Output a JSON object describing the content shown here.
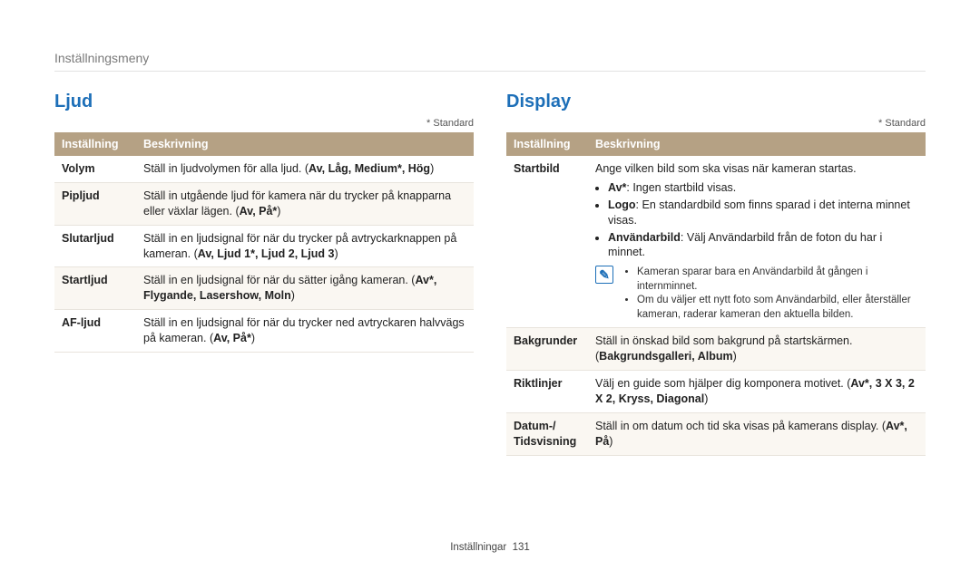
{
  "breadcrumb": "Inställningsmeny",
  "standard_note": "* Standard",
  "header": {
    "col_setting": "Inställning",
    "col_desc": "Beskrivning"
  },
  "ljud": {
    "title": "Ljud",
    "rows": [
      {
        "name": "Volym",
        "desc": "Ställ in ljudvolymen för alla ljud. (",
        "opts": "Av, Låg, Medium*, Hög",
        "tail": ")"
      },
      {
        "name": "Pipljud",
        "desc": "Ställ in utgående ljud för kamera när du trycker på knapparna eller växlar lägen. (",
        "opts": "Av, På*",
        "tail": ")"
      },
      {
        "name": "Slutarljud",
        "desc": "Ställ in en ljudsignal för när du trycker på avtryckarknappen på kameran. (",
        "opts": "Av, Ljud 1*, Ljud 2, Ljud 3",
        "tail": ")"
      },
      {
        "name": "Startljud",
        "desc": "Ställ in en ljudsignal för när du sätter igång kameran. (",
        "opts": "Av*, Flygande, Lasershow, Moln",
        "tail": ")"
      },
      {
        "name": "AF-ljud",
        "desc": "Ställ in en ljudsignal för när du trycker ned avtryckaren halvvägs på kameran. (",
        "opts": "Av, På*",
        "tail": ")"
      }
    ]
  },
  "display": {
    "title": "Display",
    "startbild": {
      "name": "Startbild",
      "intro": "Ange vilken bild som ska visas när kameran startas.",
      "bullets": [
        {
          "bold": "Av*",
          "rest": ": Ingen startbild visas."
        },
        {
          "bold": "Logo",
          "rest": ": En standardbild som finns sparad i det interna minnet visas."
        },
        {
          "bold": "Användarbild",
          "rest": ": Välj Användarbild från de foton du har i minnet."
        }
      ],
      "note_icon": "✎",
      "notes": [
        "Kameran sparar bara en Användarbild åt gången i internminnet.",
        "Om du väljer ett nytt foto som Användarbild, eller återställer kameran, raderar kameran den aktuella bilden."
      ]
    },
    "rows": [
      {
        "name": "Bakgrunder",
        "desc": "Ställ in önskad bild som bakgrund på startskärmen. (",
        "opts": "Bakgrundsgalleri, Album",
        "tail": ")"
      },
      {
        "name": "Riktlinjer",
        "desc": "Välj en guide som hjälper dig komponera motivet. (",
        "opts": "Av*, 3 X 3, 2 X 2, Kryss, Diagonal",
        "tail": ")"
      },
      {
        "name": "Datum-/ Tidsvisning",
        "desc": "Ställ in om datum och tid ska visas på kamerans display. (",
        "opts": "Av*, På",
        "tail": ")"
      }
    ]
  },
  "footer": {
    "section": "Inställningar",
    "page": "131"
  }
}
